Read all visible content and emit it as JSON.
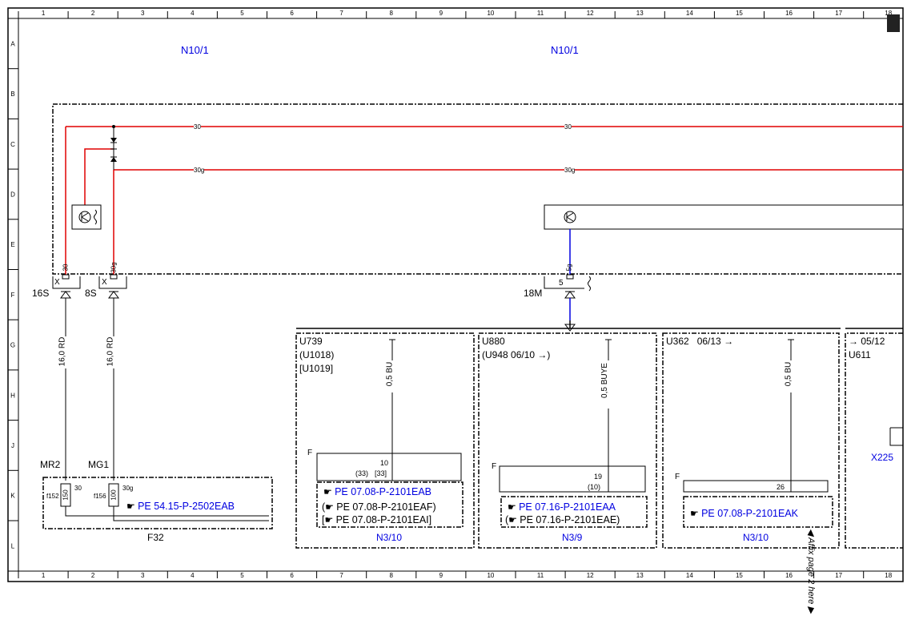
{
  "grid": {
    "columns": [
      "1",
      "2",
      "3",
      "4",
      "5",
      "6",
      "7",
      "8",
      "9",
      "10",
      "11",
      "12",
      "13",
      "14",
      "15",
      "16",
      "17",
      "18"
    ],
    "rows": [
      "A",
      "B",
      "C",
      "D",
      "E",
      "F",
      "G",
      "H",
      "J",
      "K",
      "L"
    ]
  },
  "components": {
    "n10_1_left": "N10/1",
    "n10_1_right": "N10/1"
  },
  "bus": {
    "line30_left": "30",
    "line30_right": "30",
    "line30g_left": "30g",
    "line30g_right": "30g"
  },
  "pins": {
    "pin16s": "16S",
    "pin8s": "8S",
    "pin18m": "18M",
    "x1": "X",
    "x2": "X",
    "p30": "30",
    "p30g": "30g",
    "p5": "5",
    "p5g": "5g"
  },
  "wires": {
    "w1": "16,0 RD",
    "w2": "16,0 RD",
    "w3": "0,5 BU",
    "w4": "0,5 BUYE",
    "w5": "0,5 BU"
  },
  "f32": {
    "mr2": "MR2",
    "mg1": "MG1",
    "f152": "f152",
    "f156": "f156",
    "v150": "150",
    "v100": "100",
    "t30": "30",
    "t30g": "30g",
    "ref": "PE 54.15-P-2502EAB",
    "label": "F32"
  },
  "n3_10a": {
    "u1": "U739",
    "u2": "(U1018)",
    "u3": "[U1019]",
    "f": "F",
    "pin": "10",
    "pin_a": "(33)",
    "pin_b": "[33]",
    "ref1": "PE 07.08-P-2101EAB",
    "ref2": "PE 07.08-P-2101EAF)",
    "ref3": "PE 07.08-P-2101EAI]",
    "paren2": "(",
    "paren3": "[",
    "label": "N3/10"
  },
  "n3_9": {
    "u1": "U880",
    "u2": "(U948  06/10",
    "u2_end": ")",
    "f": "F",
    "pin": "19",
    "pin_a": "(10)",
    "ref1": "PE 07.16-P-2101EAA",
    "ref2": "PE 07.16-P-2101EAE)",
    "paren2": "(",
    "label": "N3/9"
  },
  "n3_10b": {
    "u1": "U362",
    "u1b": "06/13",
    "f": "F",
    "pin": "26",
    "ref1": "PE 07.08-P-2101EAK",
    "label": "N3/10"
  },
  "right_block": {
    "u1": "05/12",
    "u2": "U611",
    "x225": "X225"
  },
  "affix": "Affix page 2 here",
  "colors": {
    "red": "#e00000",
    "blue": "#0000e0",
    "black": "#000000"
  }
}
